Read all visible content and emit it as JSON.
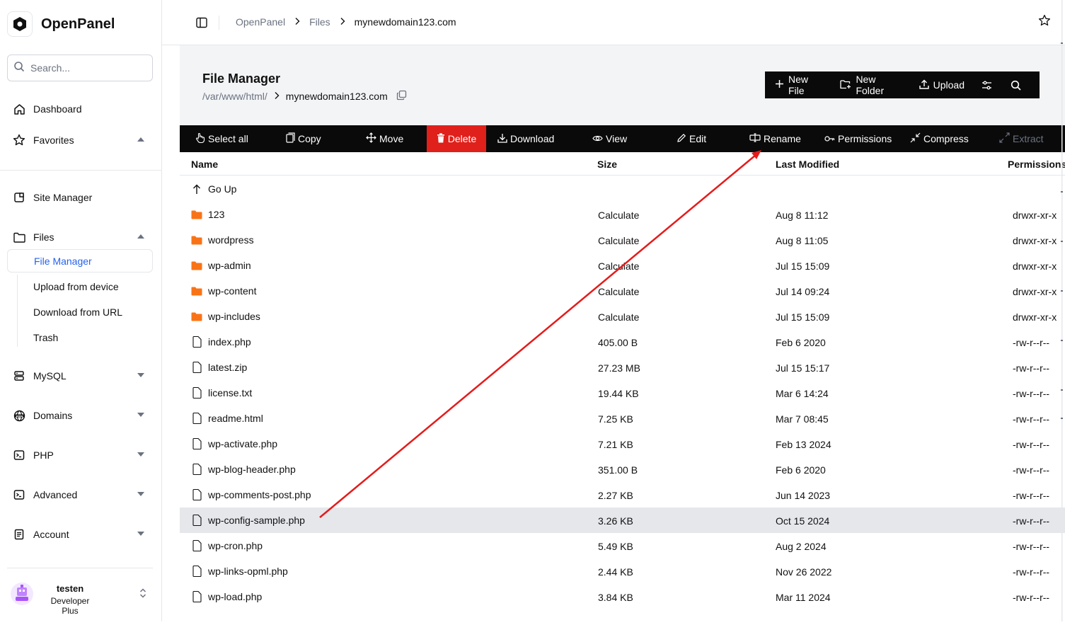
{
  "brand": {
    "name": "OpenPanel"
  },
  "search": {
    "placeholder": "Search..."
  },
  "sidebar": {
    "dashboard": "Dashboard",
    "favorites": "Favorites",
    "site_manager": "Site Manager",
    "files": "Files",
    "files_sub": [
      "File Manager",
      "Upload from device",
      "Download from URL",
      "Trash"
    ],
    "mysql": "MySQL",
    "domains": "Domains",
    "php": "PHP",
    "advanced": "Advanced",
    "account": "Account"
  },
  "user": {
    "name": "testen",
    "plan": "Developer Plus"
  },
  "breadcrumbs": [
    "OpenPanel",
    "Files",
    "mynewdomain123.com"
  ],
  "file_manager": {
    "title": "File Manager",
    "path_root": "/var/www/html/",
    "path_current": "mynewdomain123.com",
    "actions": {
      "new_file": "New File",
      "new_folder": "New Folder",
      "upload": "Upload"
    }
  },
  "toolbar": {
    "select_all": "Select all",
    "copy": "Copy",
    "move": "Move",
    "delete": "Delete",
    "download": "Download",
    "view": "View",
    "edit": "Edit",
    "rename": "Rename",
    "permissions": "Permissions",
    "compress": "Compress",
    "extract": "Extract"
  },
  "table": {
    "headers": {
      "name": "Name",
      "size": "Size",
      "modified": "Last Modified",
      "permissions": "Permissions"
    },
    "go_up": "Go Up",
    "rows": [
      {
        "name": "123",
        "type": "folder",
        "size": "Calculate",
        "modified": "Aug 8 11:12",
        "perm": "drwxr-xr-x"
      },
      {
        "name": "wordpress",
        "type": "folder",
        "size": "Calculate",
        "modified": "Aug 8 11:05",
        "perm": "drwxr-xr-x"
      },
      {
        "name": "wp-admin",
        "type": "folder",
        "size": "Calculate",
        "modified": "Jul 15 15:09",
        "perm": "drwxr-xr-x"
      },
      {
        "name": "wp-content",
        "type": "folder",
        "size": "Calculate",
        "modified": "Jul 14 09:24",
        "perm": "drwxr-xr-x"
      },
      {
        "name": "wp-includes",
        "type": "folder",
        "size": "Calculate",
        "modified": "Jul 15 15:09",
        "perm": "drwxr-xr-x"
      },
      {
        "name": "index.php",
        "type": "file",
        "size": "405.00 B",
        "modified": "Feb 6 2020",
        "perm": "-rw-r--r--"
      },
      {
        "name": "latest.zip",
        "type": "file",
        "size": "27.23 MB",
        "modified": "Jul 15 15:17",
        "perm": "-rw-r--r--"
      },
      {
        "name": "license.txt",
        "type": "file",
        "size": "19.44 KB",
        "modified": "Mar 6 14:24",
        "perm": "-rw-r--r--"
      },
      {
        "name": "readme.html",
        "type": "file",
        "size": "7.25 KB",
        "modified": "Mar 7 08:45",
        "perm": "-rw-r--r--"
      },
      {
        "name": "wp-activate.php",
        "type": "file",
        "size": "7.21 KB",
        "modified": "Feb 13 2024",
        "perm": "-rw-r--r--"
      },
      {
        "name": "wp-blog-header.php",
        "type": "file",
        "size": "351.00 B",
        "modified": "Feb 6 2020",
        "perm": "-rw-r--r--"
      },
      {
        "name": "wp-comments-post.php",
        "type": "file",
        "size": "2.27 KB",
        "modified": "Jun 14 2023",
        "perm": "-rw-r--r--"
      },
      {
        "name": "wp-config-sample.php",
        "type": "file",
        "size": "3.26 KB",
        "modified": "Oct 15 2024",
        "perm": "-rw-r--r--",
        "highlighted": true
      },
      {
        "name": "wp-cron.php",
        "type": "file",
        "size": "5.49 KB",
        "modified": "Aug 2 2024",
        "perm": "-rw-r--r--"
      },
      {
        "name": "wp-links-opml.php",
        "type": "file",
        "size": "2.44 KB",
        "modified": "Nov 26 2022",
        "perm": "-rw-r--r--"
      },
      {
        "name": "wp-load.php",
        "type": "file",
        "size": "3.84 KB",
        "modified": "Mar 11 2024",
        "perm": "-rw-r--r--"
      }
    ]
  },
  "colors": {
    "accent": "#2563eb",
    "delete": "#e0201b",
    "folder": "#f97316",
    "annotation_arrow": "#e51b1b"
  }
}
